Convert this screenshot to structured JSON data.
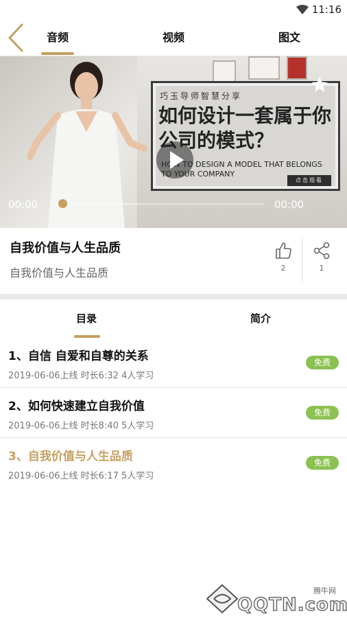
{
  "status_bar": {
    "time": "11:16"
  },
  "nav": {
    "tabs": [
      "音频",
      "视频",
      "图文"
    ],
    "active_tab": 0
  },
  "player": {
    "poster_kicker": "巧玉导师智慧分享",
    "poster_headline": "如何设计一套属于你公司的模式？",
    "poster_english_line1": "HOW TO DESIGN A MODEL THAT BELONGS",
    "poster_english_line2": "TO YOUR COMPANY",
    "poster_cta": "点击观看",
    "current_time": "00:00",
    "duration": "00:00"
  },
  "course": {
    "title": "自我价值与人生品质",
    "subtitle": "自我价值与人生品质",
    "like_count": "2",
    "share_count": "1"
  },
  "subtabs": [
    "目录",
    "简介"
  ],
  "lessons": [
    {
      "title": "1、自信 自爱和自尊的关系",
      "meta": "2019-06-06上线 时长6:32  4人学习",
      "badge": "免费"
    },
    {
      "title": "2、如何快速建立自我价值",
      "meta": "2019-06-06上线 时长8:40  5人学习",
      "badge": "免费"
    },
    {
      "title": "3、自我价值与人生品质",
      "meta": "2019-06-06上线 时长6:17  5人学习",
      "badge": "免费"
    }
  ],
  "watermark": {
    "small": "腾牛网",
    "big": "QQTN.com"
  },
  "colors": {
    "accent": "#c5a062",
    "free_badge": "#8cc152"
  }
}
